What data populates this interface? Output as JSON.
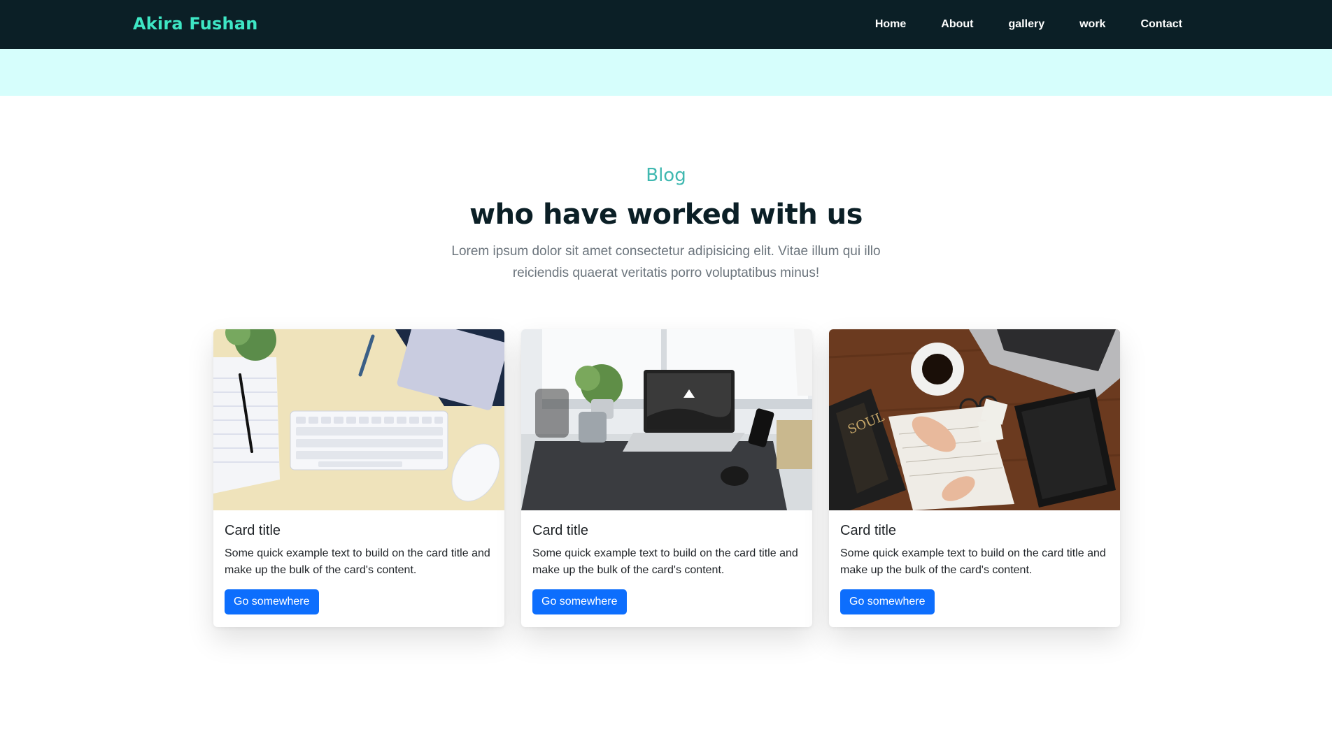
{
  "nav": {
    "brand": "Akira Fushan",
    "links": [
      "Home",
      "About",
      "gallery",
      "work",
      "Contact"
    ]
  },
  "section": {
    "eyebrow": "Blog",
    "heading": "who have worked with us",
    "lead": "Lorem ipsum dolor sit amet consectetur adipisicing elit. Vitae illum qui illo reiciendis quaerat veritatis porro voluptatibus minus!"
  },
  "cards": [
    {
      "image": "workspace-keyboard-mouse-photo",
      "title": "Card title",
      "text": "Some quick example text to build on the card title and make up the bulk of the card's content.",
      "button": "Go somewhere"
    },
    {
      "image": "laptop-desk-window-photo",
      "title": "Card title",
      "text": "Some quick example text to build on the card title and make up the bulk of the card's content.",
      "button": "Go somewhere"
    },
    {
      "image": "notebook-coffee-laptop-photo",
      "title": "Card title",
      "text": "Some quick example text to build on the card title and make up the bulk of the card's content.",
      "button": "Go somewhere"
    }
  ],
  "colors": {
    "navbar": "#0b1f26",
    "brand": "#3ee6c4",
    "band": "#d6fefc",
    "eyebrow": "#3fb8b0",
    "button": "#0d6efd"
  }
}
